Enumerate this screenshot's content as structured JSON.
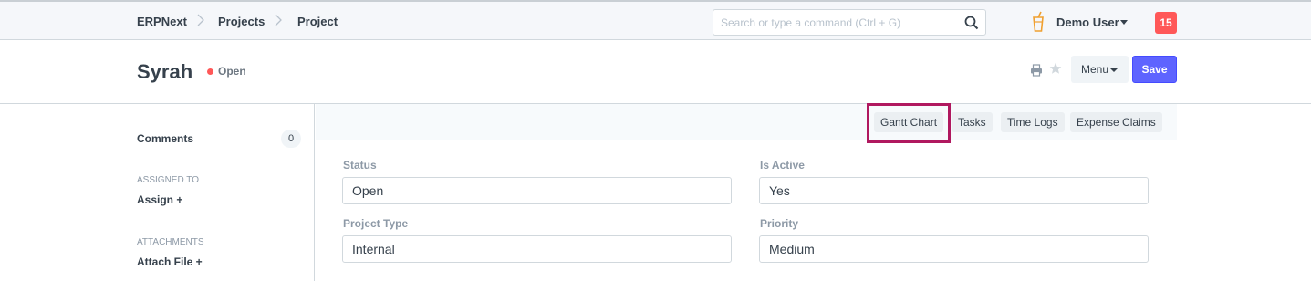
{
  "breadcrumbs": [
    "ERPNext",
    "Projects",
    "Project"
  ],
  "search": {
    "placeholder": "Search or type a command (Ctrl + G)"
  },
  "user": {
    "name": "Demo User",
    "notification_count": "15"
  },
  "page": {
    "title": "Syrah",
    "status": "Open",
    "status_color": "#ff5858"
  },
  "toolbar": {
    "menu_label": "Menu",
    "save_label": "Save",
    "save_color": "#5e64ff"
  },
  "sidebar": {
    "comments_label": "Comments",
    "comments_count": "0",
    "assigned_to_label": "ASSIGNED TO",
    "assign_link": "Assign +",
    "attachments_label": "ATTACHMENTS",
    "attach_link": "Attach File +"
  },
  "links": [
    "Gantt Chart",
    "Tasks",
    "Time Logs",
    "Expense Claims"
  ],
  "highlight_color": "#b0185f",
  "form": {
    "status": {
      "label": "Status",
      "value": "Open"
    },
    "is_active": {
      "label": "Is Active",
      "value": "Yes"
    },
    "project_type": {
      "label": "Project Type",
      "value": "Internal"
    },
    "priority": {
      "label": "Priority",
      "value": "Medium"
    }
  }
}
